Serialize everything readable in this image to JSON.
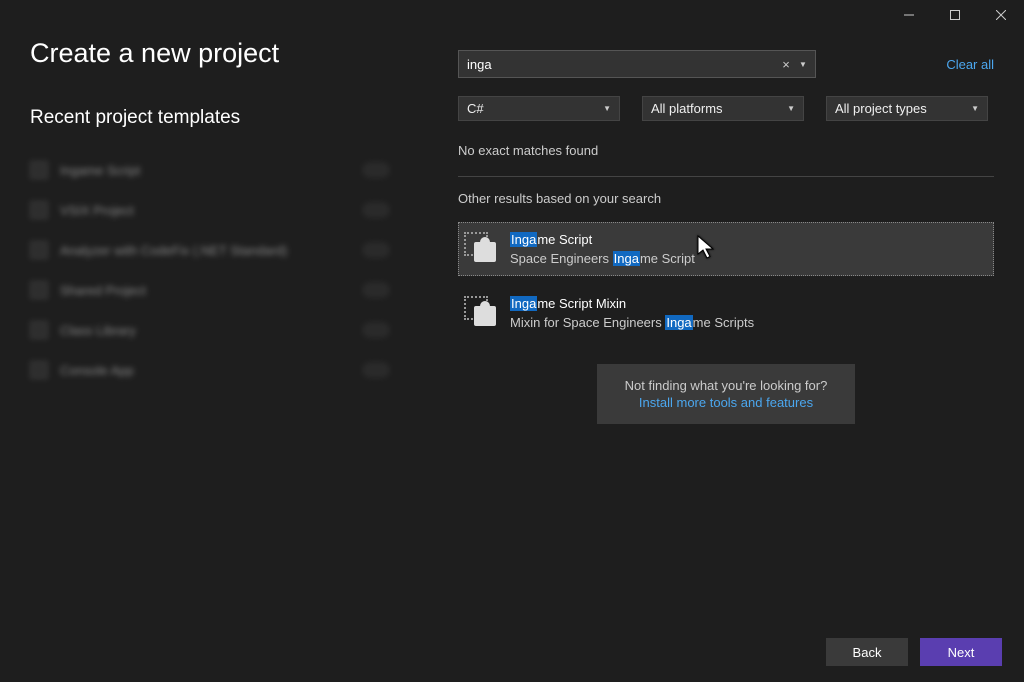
{
  "titlebar": {
    "minimize": "minimize-icon",
    "maximize": "maximize-icon",
    "close": "close-icon"
  },
  "page_title": "Create a new project",
  "recent_section_title": "Recent project templates",
  "recent_items": [
    {
      "label": "Ingame Script"
    },
    {
      "label": "VSIX Project"
    },
    {
      "label": "Analyzer with CodeFix (.NET Standard)"
    },
    {
      "label": "Shared Project"
    },
    {
      "label": "Class Library"
    },
    {
      "label": "Console App"
    }
  ],
  "search": {
    "value": "inga",
    "clear_all": "Clear all"
  },
  "filters": {
    "language": "C#",
    "platform": "All platforms",
    "project_type": "All project types"
  },
  "no_matches": "No exact matches found",
  "other_results_label": "Other results based on your search",
  "results": [
    {
      "title_pre": "Inga",
      "title_post": "me Script",
      "desc_pre": "Space Engineers ",
      "desc_hl": "Inga",
      "desc_post": "me Script",
      "selected": true
    },
    {
      "title_pre": "Inga",
      "title_post": "me Script Mixin",
      "desc_pre": "Mixin for Space Engineers ",
      "desc_hl": "Inga",
      "desc_post": "me Scripts",
      "selected": false
    }
  ],
  "prompt": {
    "text": "Not finding what you're looking for?",
    "link": "Install more tools and features"
  },
  "footer": {
    "back": "Back",
    "next": "Next"
  }
}
